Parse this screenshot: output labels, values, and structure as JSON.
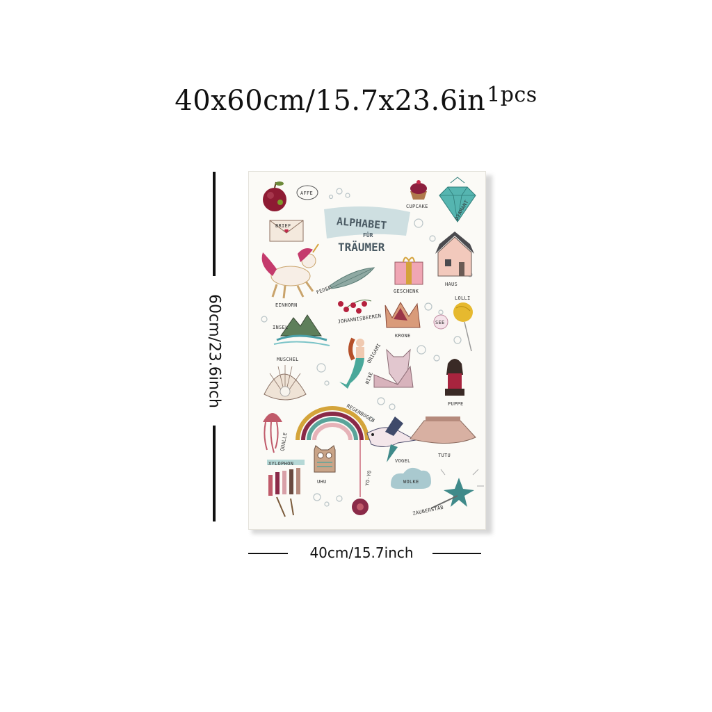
{
  "headline": {
    "size": "40x60cm/15.7x23.6in",
    "qty": "1pcs"
  },
  "dimensions": {
    "height": "60cm/23.6inch",
    "width": "40cm/15.7inch"
  },
  "poster": {
    "title_line1": "ALPHABET",
    "title_line2": "FÜR",
    "title_line3": "TRÄUMER",
    "words": {
      "affe": "AFFE",
      "cupcake": "CUPCAKE",
      "diamant": "DIAMANT",
      "brief": "BRIEF",
      "haus": "HAUS",
      "feder": "FEDER",
      "geschenk": "GESCHENK",
      "einhorn": "EINHORN",
      "johannisbeeren": "JOHANNISBEEREN",
      "lolli": "LOLLI",
      "insel": "INSEL",
      "krone": "KRONE",
      "see": "SEE",
      "muschel": "MUSCHEL",
      "nixe": "NIXE",
      "origami": "ORIGAMI",
      "puppe": "PUPPE",
      "qualle": "QUALLE",
      "regenbogen": "REGENBOGEN",
      "vogel": "VOGEL",
      "tutu": "TUTU",
      "uhu": "UHU",
      "xylophon": "XYLOPHON",
      "yoyo": "YO-YO",
      "wolke": "WOLKE",
      "zauberstab": "ZAUBERSTAB"
    }
  }
}
